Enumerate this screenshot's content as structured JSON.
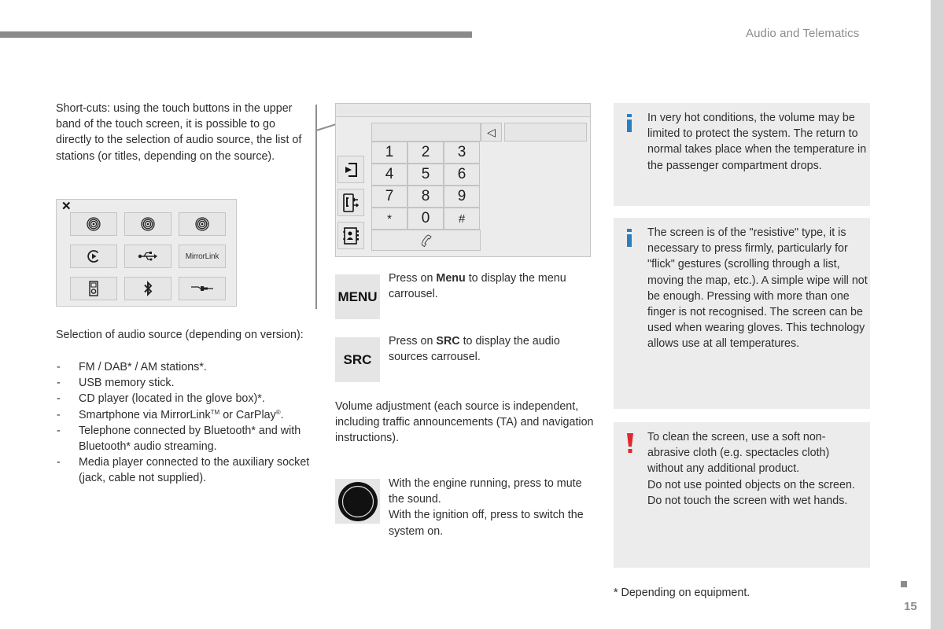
{
  "header": {
    "section_title": "Audio and Telematics"
  },
  "left": {
    "shortcuts_text": "Short-cuts: using the touch buttons in the upper band of the touch screen, it is possible to go directly to the selection of audio source, the list of stations (or titles, depending on the source).",
    "source_panel": {
      "close_icon": "close-icon",
      "buttons": [
        {
          "icon": "radio-icon"
        },
        {
          "icon": "radio-icon"
        },
        {
          "icon": "radio-icon"
        },
        {
          "icon": "cd-play-icon"
        },
        {
          "icon": "usb-icon"
        },
        {
          "icon": "mirrorlink-logo",
          "label": "MirrorLink"
        },
        {
          "icon": "media-player-icon"
        },
        {
          "icon": "bluetooth-icon"
        },
        {
          "icon": "jack-icon"
        }
      ]
    },
    "source_intro": "Selection of audio source (depending on version):",
    "source_list": [
      "FM / DAB* / AM stations*.",
      "USB memory stick.",
      "CD player (located in the glove box)*.",
      {
        "pre": "Smartphone via MirrorLink",
        "sup1": "TM",
        "mid": " or CarPlay",
        "sup2": "®",
        "post": "."
      },
      "Telephone connected by Bluetooth* and with Bluetooth* audio streaming.",
      "Media player connected to the auxiliary socket (jack, cable not supplied)."
    ],
    "dash": "-"
  },
  "phone_screen": {
    "backspace_icon": "◁",
    "keys": [
      "1",
      "2",
      "3",
      "4",
      "5",
      "6",
      "7",
      "8",
      "9",
      "*",
      "0",
      "#"
    ],
    "call_icon": "handset-icon",
    "side_icons": [
      "call-log-icon",
      "call-transfer-icon",
      "contacts-icon"
    ]
  },
  "middle": {
    "menu": {
      "button_label": "MENU",
      "desc_pre": "Press on ",
      "desc_bold": "Menu",
      "desc_post": " to display the menu carrousel."
    },
    "src": {
      "button_label": "SRC",
      "desc_pre": "Press on ",
      "desc_bold": "SRC",
      "desc_post": " to display the audio sources carrousel."
    },
    "volume_text": "Volume adjustment (each source is independent, including traffic announcements (TA) and navigation instructions).",
    "knob": {
      "line1": "With the engine running, press to mute the sound.",
      "line2": "With the ignition off, press to switch the system on."
    }
  },
  "notes": [
    {
      "type": "info",
      "icon": "info-icon",
      "color": "#2b7fc1",
      "text": "In very hot conditions, the volume may be limited to protect the system. The return to normal takes place when the temperature in the passenger compartment drops."
    },
    {
      "type": "info",
      "icon": "info-icon",
      "color": "#2b7fc1",
      "text": "The screen is of the \"resistive\" type, it is necessary to press firmly, particularly for \"flick\" gestures (scrolling through a list, moving the map, etc.). A simple wipe will not be enough. Pressing with more than one finger is not recognised. The screen can be used when wearing gloves. This technology allows use at all temperatures."
    },
    {
      "type": "warning",
      "icon": "warning-icon",
      "color": "#e0262f",
      "line1": "To clean the screen, use a soft non-abrasive cloth (e.g. spectacles cloth) without any additional product.",
      "line2": "Do not use pointed objects on the screen.",
      "line3": "Do not touch the screen with wet hands."
    }
  ],
  "footer": {
    "footnote": "* Depending on equipment.",
    "page_number": "15"
  }
}
